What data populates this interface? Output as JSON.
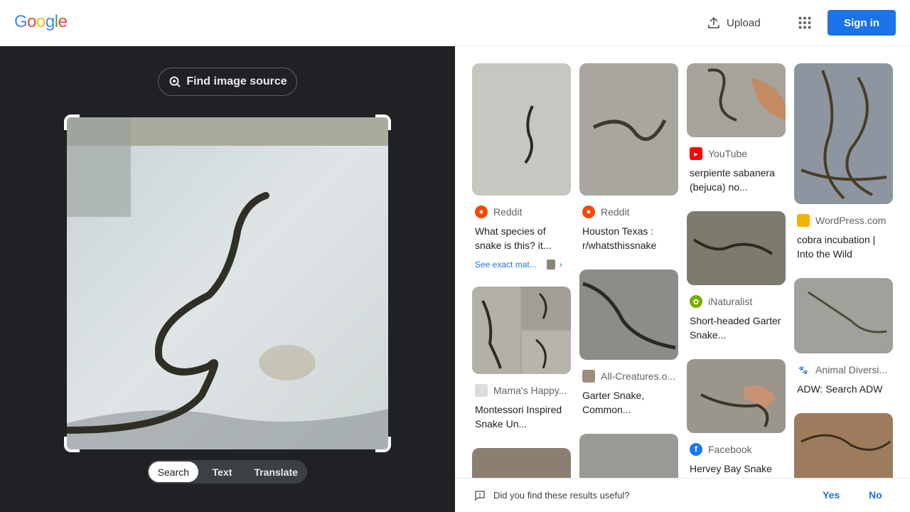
{
  "brand": {
    "logo_letters": [
      "G",
      "o",
      "o",
      "g",
      "l",
      "e"
    ]
  },
  "header": {
    "upload_label": "Upload",
    "apps_icon": "apps-grid-icon",
    "signin_label": "Sign in",
    "accent": "#1a73e8"
  },
  "lens": {
    "find_source_label": "Find image source",
    "modes": [
      "Search",
      "Text",
      "Translate"
    ],
    "active_mode": "Search"
  },
  "results": {
    "col1": [
      {
        "source": "Reddit",
        "title": "What species of snake is this? it...",
        "exact_match": "See exact mat..."
      },
      {
        "source": "Mama's Happy...",
        "title": "Montessori Inspired Snake Un..."
      }
    ],
    "col2": [
      {
        "source": "Reddit",
        "title": "Houston Texas : r/whatsthissnake"
      },
      {
        "source": "All-Creatures.o...",
        "title": "Garter Snake, Common..."
      }
    ],
    "col3": [
      {
        "source": "YouTube",
        "title": "serpiente sabanera (bejuca) no..."
      },
      {
        "source": "iNaturalist",
        "title": "Short-headed Garter Snake..."
      },
      {
        "source": "Facebook",
        "title": "Hervey Bay Snake Catchers"
      }
    ],
    "col4": [
      {
        "source": "WordPress.com",
        "title": "cobra incubation | Into the Wild"
      },
      {
        "source": "Animal Diversi...",
        "title": "ADW: Search ADW"
      }
    ]
  },
  "feedback": {
    "question": "Did you find these results useful?",
    "yes": "Yes",
    "no": "No"
  }
}
